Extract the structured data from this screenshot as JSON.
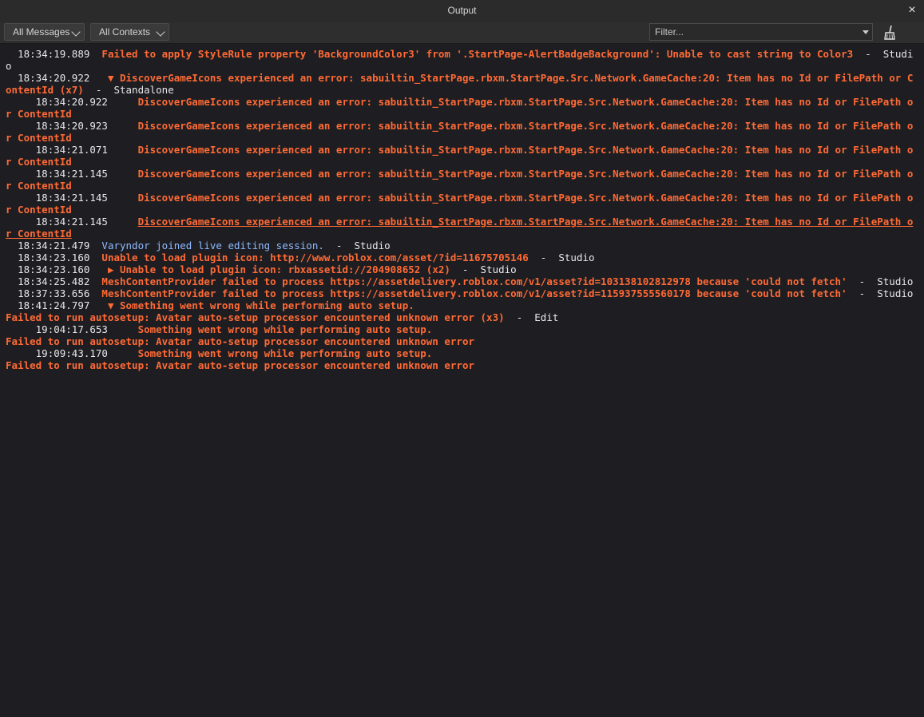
{
  "window": {
    "title": "Output",
    "close_glyph": "×"
  },
  "toolbar": {
    "messages_filter": "All Messages",
    "contexts_filter": "All Contexts",
    "filter_placeholder": "Filter...",
    "clear_icon": "broom-icon"
  },
  "colors": {
    "error": "#ff6a35",
    "info": "#8fb9ff",
    "timestamp": "#e8e8e8",
    "background": "#1e1e22"
  },
  "log": [
    {
      "ts": "  18:34:19.889  ",
      "tri": "",
      "msg": "Failed to apply StyleRule property 'BackgroundColor3' from '.StartPage-AlertBadgeBackground': Unable to cast string to Color3",
      "src": "  -  Studio",
      "kind": "err"
    },
    {
      "ts": "  18:34:20.922  ",
      "tri": " ▼ ",
      "msg": "DiscoverGameIcons experienced an error: sabuiltin_StartPage.rbxm.StartPage.Src.Network.GameCache:20: Item has no Id or FilePath or ContentId (x7)",
      "src": "  -  Standalone",
      "kind": "err"
    },
    {
      "ts": "     18:34:20.922     ",
      "tri": "",
      "msg": "DiscoverGameIcons experienced an error: sabuiltin_StartPage.rbxm.StartPage.Src.Network.GameCache:20: Item has no Id or FilePath or ContentId",
      "src": "",
      "kind": "err"
    },
    {
      "ts": "     18:34:20.923     ",
      "tri": "",
      "msg": "DiscoverGameIcons experienced an error: sabuiltin_StartPage.rbxm.StartPage.Src.Network.GameCache:20: Item has no Id or FilePath or ContentId",
      "src": "",
      "kind": "err"
    },
    {
      "ts": "     18:34:21.071     ",
      "tri": "",
      "msg": "DiscoverGameIcons experienced an error: sabuiltin_StartPage.rbxm.StartPage.Src.Network.GameCache:20: Item has no Id or FilePath or ContentId",
      "src": "",
      "kind": "err"
    },
    {
      "ts": "     18:34:21.145     ",
      "tri": "",
      "msg": "DiscoverGameIcons experienced an error: sabuiltin_StartPage.rbxm.StartPage.Src.Network.GameCache:20: Item has no Id or FilePath or ContentId",
      "src": "",
      "kind": "err"
    },
    {
      "ts": "     18:34:21.145     ",
      "tri": "",
      "msg": "DiscoverGameIcons experienced an error: sabuiltin_StartPage.rbxm.StartPage.Src.Network.GameCache:20: Item has no Id or FilePath or ContentId",
      "src": "",
      "kind": "err"
    },
    {
      "ts": "     18:34:21.145     ",
      "tri": "",
      "msg": "DiscoverGameIcons experienced an error: sabuiltin_StartPage.rbxm.StartPage.Src.Network.GameCache:20: Item has no Id or FilePath or ContentId",
      "src": "",
      "kind": "err-u"
    },
    {
      "ts": "  18:34:21.479  ",
      "tri": "",
      "msg": "Varyndor joined live editing session.",
      "src": "  -  Studio",
      "kind": "info"
    },
    {
      "ts": "  18:34:23.160  ",
      "tri": "",
      "msg": "Unable to load plugin icon: http://www.roblox.com/asset/?id=11675705146",
      "src": "  -  Studio",
      "kind": "err"
    },
    {
      "ts": "  18:34:23.160  ",
      "tri": " ▶ ",
      "msg": "Unable to load plugin icon: rbxassetid://204908652 (x2)",
      "src": "  -  Studio",
      "kind": "err"
    },
    {
      "ts": "  18:34:25.482  ",
      "tri": "",
      "msg": "MeshContentProvider failed to process https://assetdelivery.roblox.com/v1/asset?id=103138102812978 because 'could not fetch'",
      "src": "  -  Studio",
      "kind": "err"
    },
    {
      "ts": "  18:37:33.656  ",
      "tri": "",
      "msg": "MeshContentProvider failed to process https://assetdelivery.roblox.com/v1/asset?id=115937555560178 because 'could not fetch'",
      "src": "  -  Studio",
      "kind": "err"
    },
    {
      "ts": "  18:41:24.797  ",
      "tri": " ▼ ",
      "msg": "Something went wrong while performing auto setup.\nFailed to run autosetup: Avatar auto-setup processor encountered unknown error (x3)",
      "src": "  -  Edit",
      "kind": "err"
    },
    {
      "ts": "     19:04:17.653     ",
      "tri": "",
      "msg": "Something went wrong while performing auto setup.\nFailed to run autosetup: Avatar auto-setup processor encountered unknown error",
      "src": "",
      "kind": "err"
    },
    {
      "ts": "     19:09:43.170     ",
      "tri": "",
      "msg": "Something went wrong while performing auto setup.\nFailed to run autosetup: Avatar auto-setup processor encountered unknown error",
      "src": "",
      "kind": "err"
    }
  ]
}
